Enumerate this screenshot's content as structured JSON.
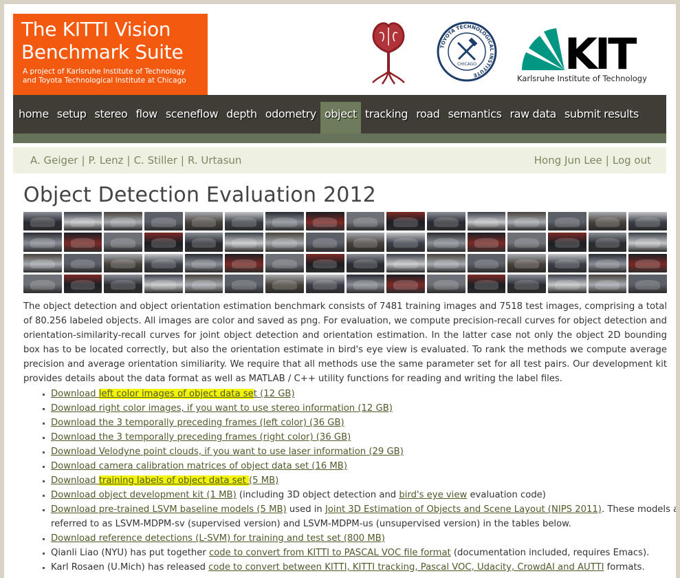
{
  "header": {
    "logo_title": "The KITTI Vision\nBenchmark Suite",
    "logo_subtitle": "A project of Karlsruhe Institute of Technology\nand Toyota Technological Institute at Chicago",
    "tti_logo_text": "TOYOTA TECHNOLOGICAL INSTITUTE",
    "tti_logo_city": "CHICAGO",
    "kit_logo_text": "KIT",
    "kit_caption": "Karlsruhe Institute of Technology"
  },
  "nav": {
    "items": [
      "home",
      "setup",
      "stereo",
      "flow",
      "sceneflow",
      "depth",
      "odometry",
      "object",
      "tracking",
      "road",
      "semantics",
      "raw data",
      "submit results"
    ],
    "active": "object"
  },
  "subbar": {
    "authors": [
      "A. Geiger",
      "P. Lenz",
      "C. Stiller",
      "R. Urtasun"
    ],
    "user": "Hong Jun Lee",
    "logout": "Log out",
    "separator": "|"
  },
  "page_title": "Object Detection Evaluation 2012",
  "description": "The object detection and object orientation estimation benchmark consists of 7481 training images and 7518 test images, comprising a total of 80.256 labeled objects. All images are color and saved as png. For evaluation, we compute precision-recall curves for object detection and orientation-similarity-recall curves for joint object detection and orientation estimation. In the latter case not only the object 2D bounding box has to be located correctly, but also the orientation estimate in bird's eye view is evaluated. To rank the methods we compute average precision and average orientation similiarity. We require that all methods use the same parameter set for all test pairs. Our development kit provides details about the data format as well as MATLAB / C++ utility functions for reading and writing the label files.",
  "downloads": {
    "i1": {
      "pre": "Download ",
      "hl": "left color images of object data se",
      "post": "t (12 GB)"
    },
    "i2": "Download right color images, if you want to use stereo information (12 GB)",
    "i3": "Download the 3 temporally preceding frames (left color) (36 GB)",
    "i4": "Download the 3 temporally preceding frames (right color) (36 GB)",
    "i5": "Download Velodyne point clouds, if you want to use laser information (29 GB)",
    "i6": "Download camera calibration matrices of object data set (16 MB)",
    "i7": {
      "pre": "Download ",
      "hl": "training labels of object data set ",
      "post": "(5 MB)"
    },
    "i8": {
      "link1": "Download object development kit (1 MB)",
      "text1": " (including 3D object detection and ",
      "link2": "bird's eye view",
      "text2": " evaluation code)"
    },
    "i9": {
      "link1": "Download pre-trained LSVM baseline models (5 MB)",
      "text1": " used in ",
      "link2": "Joint 3D Estimation of Objects and Scene Layout (NIPS 2011)",
      "text2": ". These models are referred to as LSVM-MDPM-sv (supervised version) and LSVM-MDPM-us (unsupervised version) in the tables below."
    },
    "i10": "Download reference detections (L-SVM) for training and test set (800 MB)",
    "i11": {
      "text1": "Qianli Liao (NYU) has put together ",
      "link1": "code to convert from KITTI to PASCAL VOC file format",
      "text2": " (documentation included, requires Emacs)."
    },
    "i12": {
      "text1": "Karl Rosaen (U.Mich) has released ",
      "link1": "code to convert between KITTI, KITTI tracking, Pascal VOC, Udacity, CrowdAI and AUTTI",
      "text2": " formats."
    }
  },
  "colors": {
    "logo_bg": "#f35a0f",
    "nav_bg": "#3f3d35",
    "nav_active": "#6e7c5b",
    "subbar_bg": "#eef0e2",
    "link": "#4d5b2a",
    "highlight": "#f4f40b"
  }
}
